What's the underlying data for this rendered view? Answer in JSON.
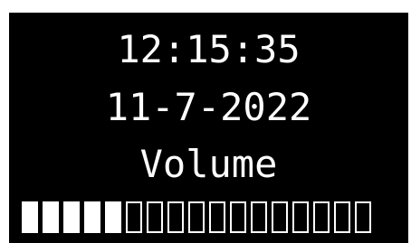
{
  "display": {
    "time": "12:15:35",
    "date": "11-7-2022",
    "label": "Volume"
  },
  "volume": {
    "level": 5,
    "max": 17
  },
  "colors": {
    "screen_background": "#000000",
    "text": "#ffffff",
    "page_background": "#ffffff"
  }
}
